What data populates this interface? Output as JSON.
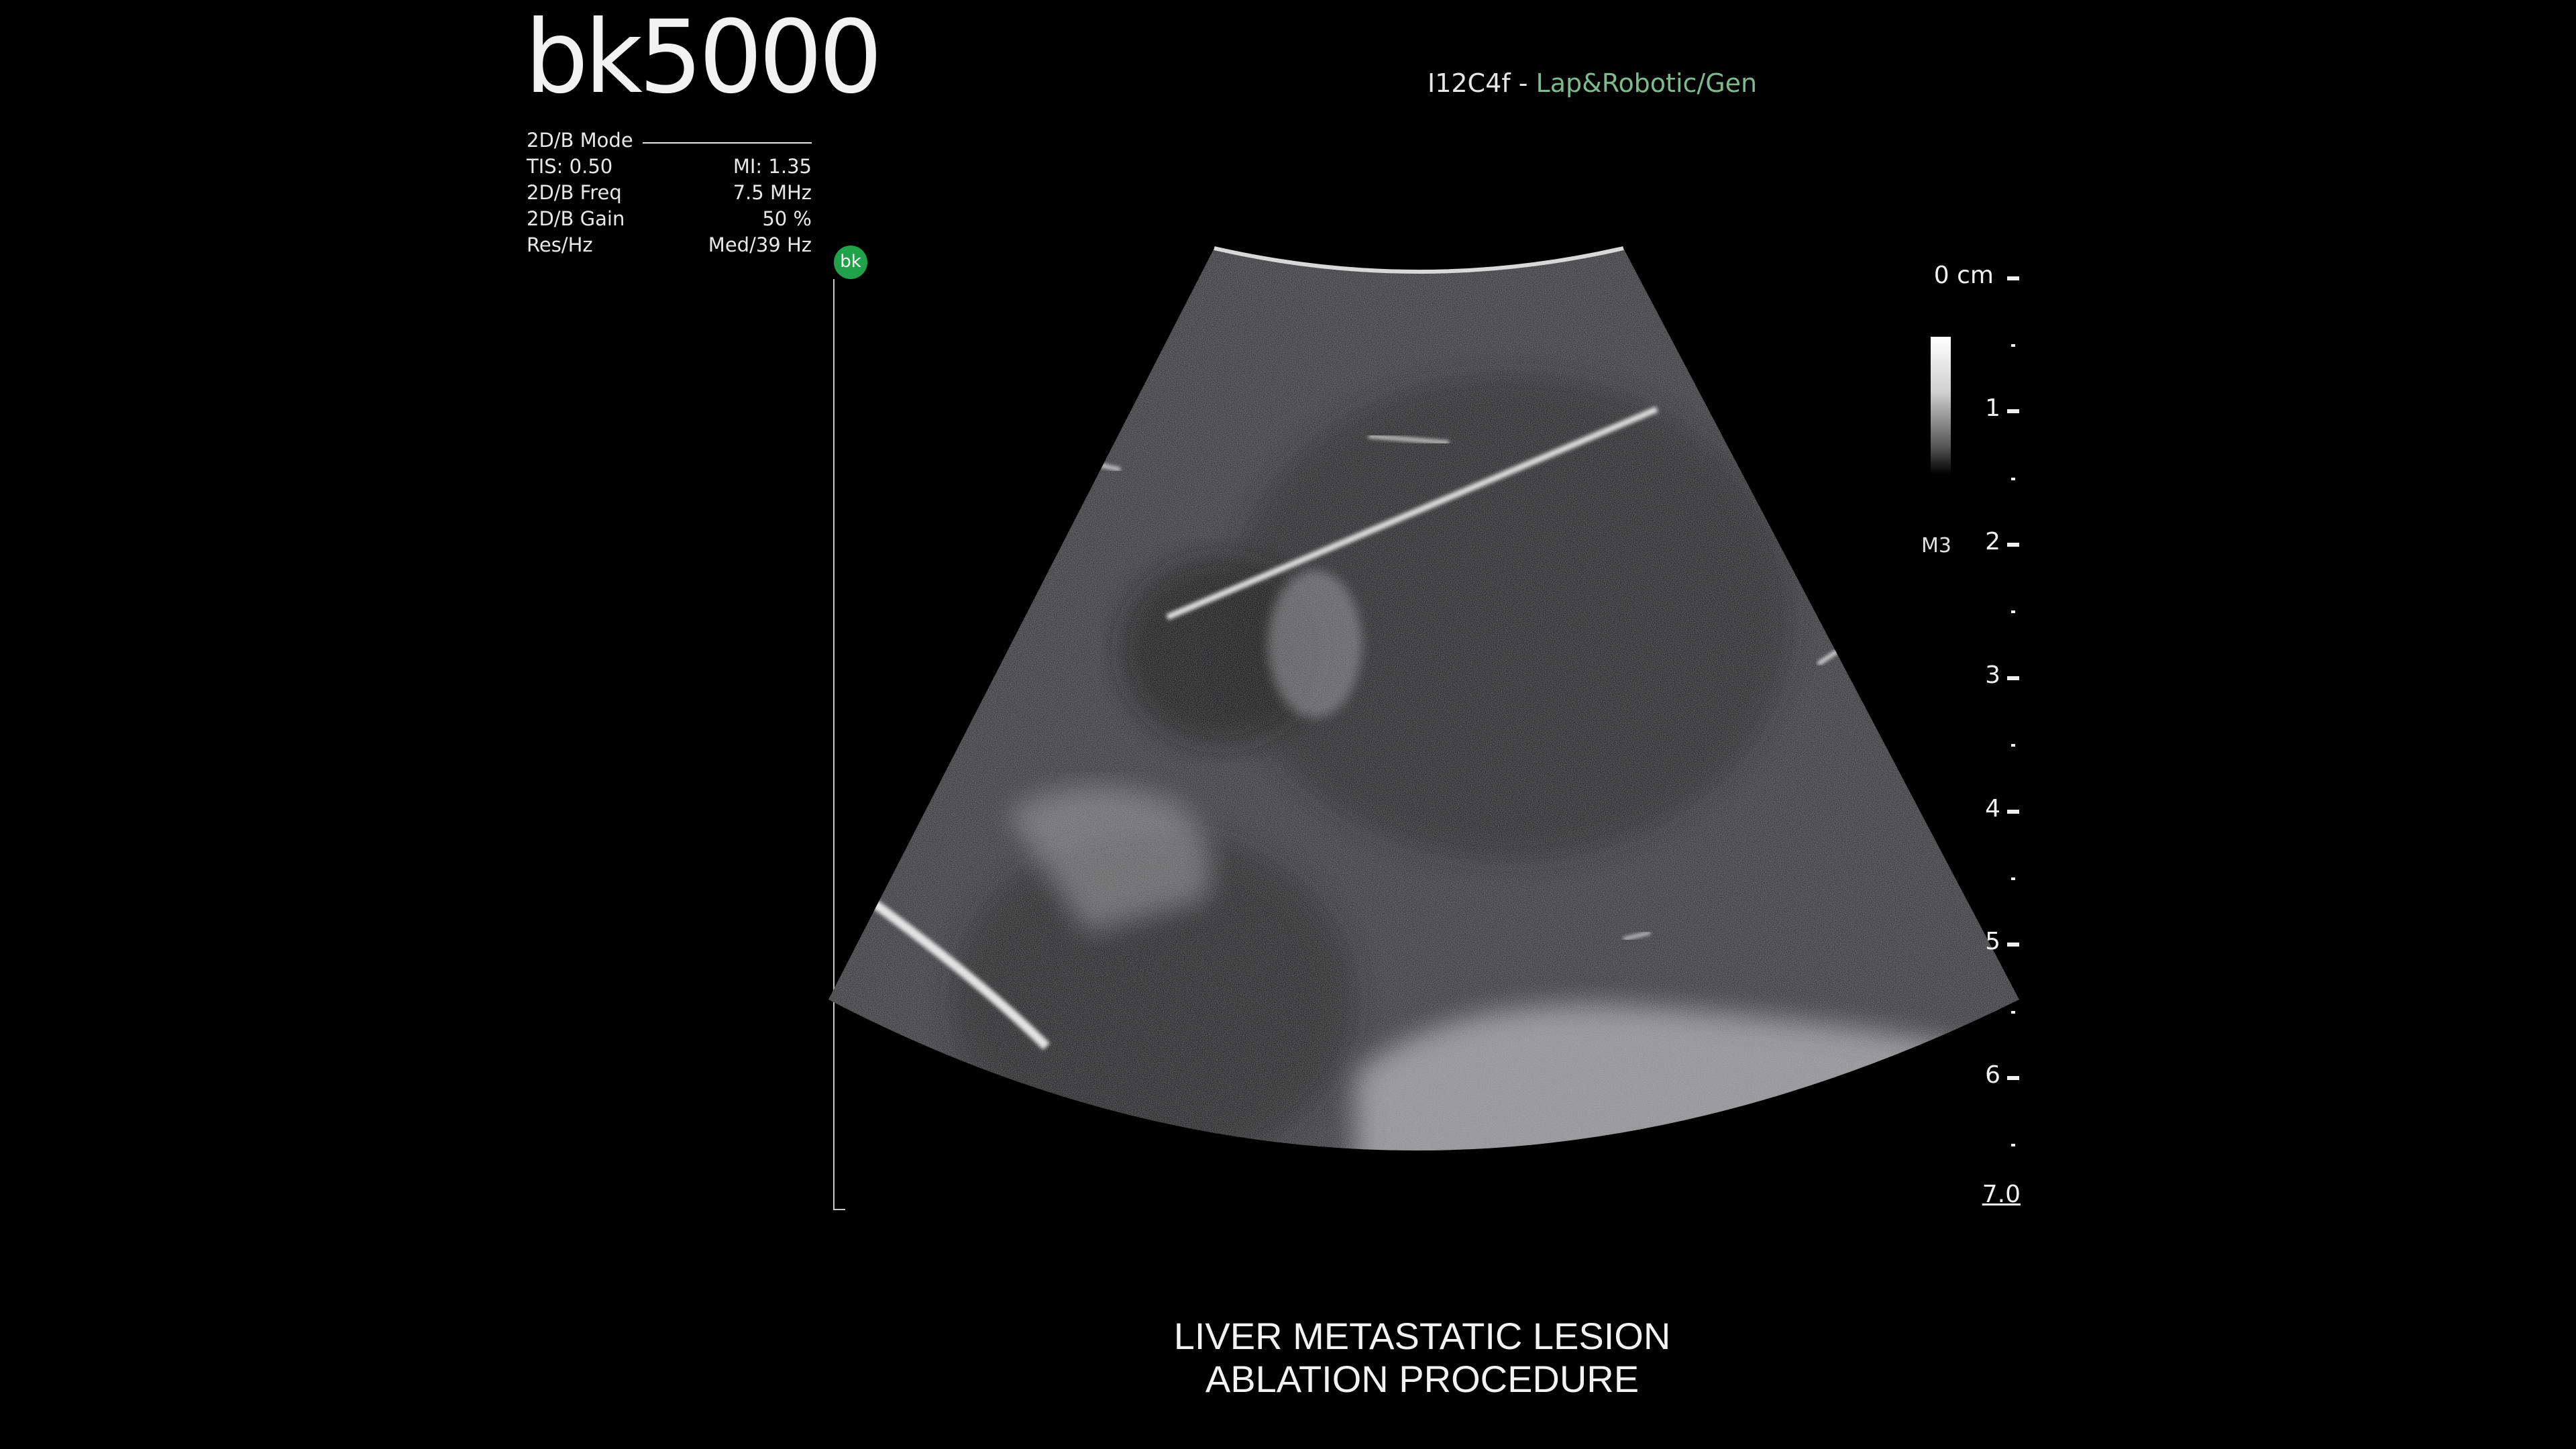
{
  "brand": {
    "logo_text": "bk5000"
  },
  "probe": {
    "name": "I12C4f",
    "separator": " - ",
    "preset": "Lap&Robotic/Gen"
  },
  "params": {
    "mode": "2D/B Mode",
    "rows": [
      {
        "label": "TIS: 0.50",
        "value": "MI: 1.35"
      },
      {
        "label": "2D/B Freq",
        "value": "7.5 MHz"
      },
      {
        "label": "2D/B Gain",
        "value": "50 %"
      },
      {
        "label": "Res/Hz",
        "value": "Med/39 Hz"
      }
    ]
  },
  "marker": {
    "label": "bk",
    "color": "#1fa24a"
  },
  "depth_scale": {
    "unit_label": "0 cm",
    "labels": [
      "1",
      "2",
      "3",
      "4",
      "5",
      "6"
    ],
    "max_label": "7.0"
  },
  "gray_map": {
    "label": "M3"
  },
  "caption": {
    "line1": "LIVER METASTATIC LESION",
    "line2": "ABLATION PROCEDURE"
  },
  "colors": {
    "preset_green": "#7dbb8e",
    "background": "#000000"
  }
}
